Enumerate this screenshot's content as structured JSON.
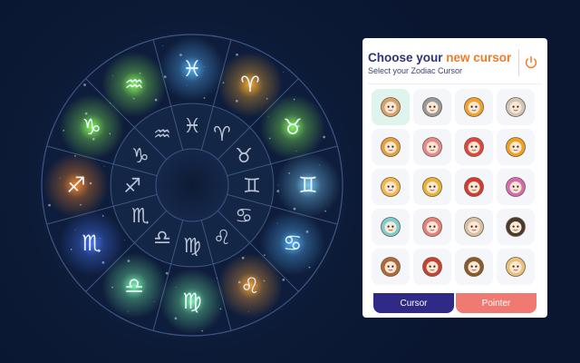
{
  "panel": {
    "title_lead": "Choose your ",
    "title_accent": "new cursor",
    "subtitle": "Select your Zodiac Cursor",
    "icons": {
      "close": "power-icon"
    },
    "colors": {
      "accent": "#f07c2a",
      "navy": "#2f3572",
      "selected_bg": "#dff4ec"
    }
  },
  "cursor_grid": {
    "selected_index": 0,
    "items": [
      {
        "icon": "aquarius-figure",
        "color": "#d7a16a",
        "bg": "#ffffff"
      },
      {
        "icon": "capricorn-goat",
        "color": "#9a9a9a",
        "bg": "#ffffff"
      },
      {
        "icon": "pisces-fish",
        "color": "#f5a02a",
        "bg": "#ffffff"
      },
      {
        "icon": "aries-ram",
        "color": "#cfc6b8",
        "bg": "#ffffff"
      },
      {
        "icon": "taurus-bull",
        "color": "#e7a03a",
        "bg": "#ffffff"
      },
      {
        "icon": "gemini-twins",
        "color": "#e98a8a",
        "bg": "#ffffff"
      },
      {
        "icon": "cancer-crab",
        "color": "#e2453c",
        "bg": "#ffffff"
      },
      {
        "icon": "leo-lion",
        "color": "#f0a21c",
        "bg": "#ffffff"
      },
      {
        "icon": "virgo-maiden",
        "color": "#f4b84a",
        "bg": "#ffffff"
      },
      {
        "icon": "libra-scales",
        "color": "#e8b432",
        "bg": "#ffffff"
      },
      {
        "icon": "scorpio-scorpion",
        "color": "#d6392f",
        "bg": "#ffffff"
      },
      {
        "icon": "sagittarius-archer",
        "color": "#d96ab0",
        "bg": "#ffffff"
      },
      {
        "icon": "aquarius-girl",
        "color": "#7ccfd0",
        "bg": "#ffffff"
      },
      {
        "icon": "pisces-girl",
        "color": "#e8807c",
        "bg": "#ffffff"
      },
      {
        "icon": "aries-girl",
        "color": "#d6c2a6",
        "bg": "#ffffff"
      },
      {
        "icon": "taurus-girl",
        "color": "#4a3a2a",
        "bg": "#ffffff"
      },
      {
        "icon": "gemini-girl",
        "color": "#b06a3a",
        "bg": "#ffffff"
      },
      {
        "icon": "cancer-girl",
        "color": "#c9402e",
        "bg": "#ffffff"
      },
      {
        "icon": "leo-girl",
        "color": "#8a5a2a",
        "bg": "#ffffff"
      },
      {
        "icon": "virgo-girl",
        "color": "#e8c27a",
        "bg": "#ffffff"
      }
    ]
  },
  "buttons": {
    "cursor_label": "Cursor",
    "pointer_label": "Pointer",
    "colors": {
      "cursor": "#2e2a86",
      "pointer": "#f07a72"
    }
  },
  "wheel": {
    "glyphs": [
      "♓",
      "♈",
      "♉",
      "♊",
      "♋",
      "♌",
      "♍",
      "♎",
      "♏",
      "♐",
      "♑",
      "♒"
    ],
    "icons": [
      "pisces-icon",
      "aries-icon",
      "taurus-icon",
      "gemini-icon",
      "cancer-icon",
      "leo-icon",
      "virgo-icon",
      "libra-icon",
      "scorpio-icon",
      "sagittarius-icon",
      "capricorn-icon",
      "aquarius-icon"
    ],
    "glow_colors": [
      "#59b7ff",
      "#ffb02e",
      "#8cff5a",
      "#7fd4ff",
      "#59b7ff",
      "#ffa63a",
      "#7dffb0",
      "#7dffb0",
      "#4a78ff",
      "#ff8a2a",
      "#8cff5a",
      "#8cff5a"
    ]
  }
}
